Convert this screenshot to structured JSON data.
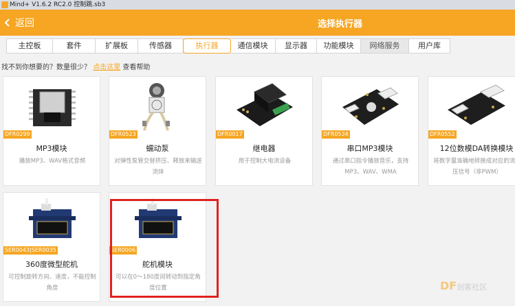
{
  "window": {
    "title": "Mind+ V1.6.2 RC2.0   控制跳.sb3"
  },
  "header": {
    "back_label": "返回",
    "title": "选择执行器"
  },
  "tabs": [
    {
      "label": "主控板"
    },
    {
      "label": "套件"
    },
    {
      "label": "扩展板"
    },
    {
      "label": "传感器"
    },
    {
      "label": "执行器",
      "active": true
    },
    {
      "label": "通信模块"
    },
    {
      "label": "显示器"
    },
    {
      "label": "功能模块"
    },
    {
      "label": "网络服务"
    },
    {
      "label": "用户库"
    }
  ],
  "hint": {
    "text": "找不到你想要的？数量很少？",
    "link": "点击这里",
    "after": "查看帮助"
  },
  "cards": [
    {
      "sku": "DFR0299",
      "name": "MP3模块",
      "desc": "播放MP3、WAV格式音频",
      "icon": "mp3-module-image"
    },
    {
      "sku": "DFR0523",
      "name": "蠕动泵",
      "desc": "对弹性泵管交替挤压、释放来输送流体",
      "icon": "peristaltic-pump-image"
    },
    {
      "sku": "DFR0017",
      "name": "继电器",
      "desc": "用于控制大电流设备",
      "icon": "relay-image"
    },
    {
      "sku": "DFR0534",
      "name": "串口MP3模块",
      "desc": "通过串口指令播放音乐，支持MP3、WAV、WMA",
      "icon": "serial-mp3-image"
    },
    {
      "sku": "DFR0552",
      "name": "12位数模DA转换模块",
      "desc": "将数字量准确地转换成对应的流电压信号（非PWM）",
      "icon": "dac-module-image"
    },
    {
      "sku": "SER0043|SER0035",
      "name": "360度微型舵机",
      "desc": "可控制旋转方向、速度，不能控制角度",
      "icon": "servo-360-image"
    },
    {
      "sku": "SER0006",
      "name": "舵机模块",
      "desc": "可以在0～180度间转动到指定角度位置",
      "icon": "servo-image",
      "selected": true
    }
  ],
  "watermark": {
    "brand": "DF",
    "text": "创客社区"
  },
  "colors": {
    "accent": "#f6a623",
    "selection": "#e02020"
  }
}
